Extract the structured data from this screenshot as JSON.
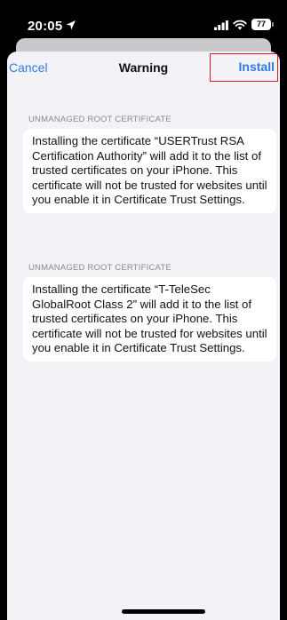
{
  "status_bar": {
    "time": "20:05",
    "battery": "77"
  },
  "nav": {
    "cancel_label": "Cancel",
    "title": "Warning",
    "install_label": "Install"
  },
  "sections": [
    {
      "header": "UNMANAGED ROOT CERTIFICATE",
      "body": "Installing the certificate “USERTrust RSA Certification Authority” will add it to the list of trusted certificates on your iPhone. This certificate will not be trusted for websites until you enable it in Certificate Trust Settings."
    },
    {
      "header": "UNMANAGED ROOT CERTIFICATE",
      "body": "Installing the certificate “T-TeleSec GlobalRoot Class 2” will add it to the list of trusted certificates on your iPhone. This certificate will not be trusted for websites until you enable it in Certificate Trust Settings."
    }
  ],
  "icons": {
    "location": "location-arrow-icon",
    "signal": "cellular-signal-icon",
    "wifi": "wifi-icon",
    "battery": "battery-icon"
  },
  "colors": {
    "accent": "#2f7de1",
    "highlight_box": "#e0161e",
    "sheet_background": "#f2f2f7"
  }
}
